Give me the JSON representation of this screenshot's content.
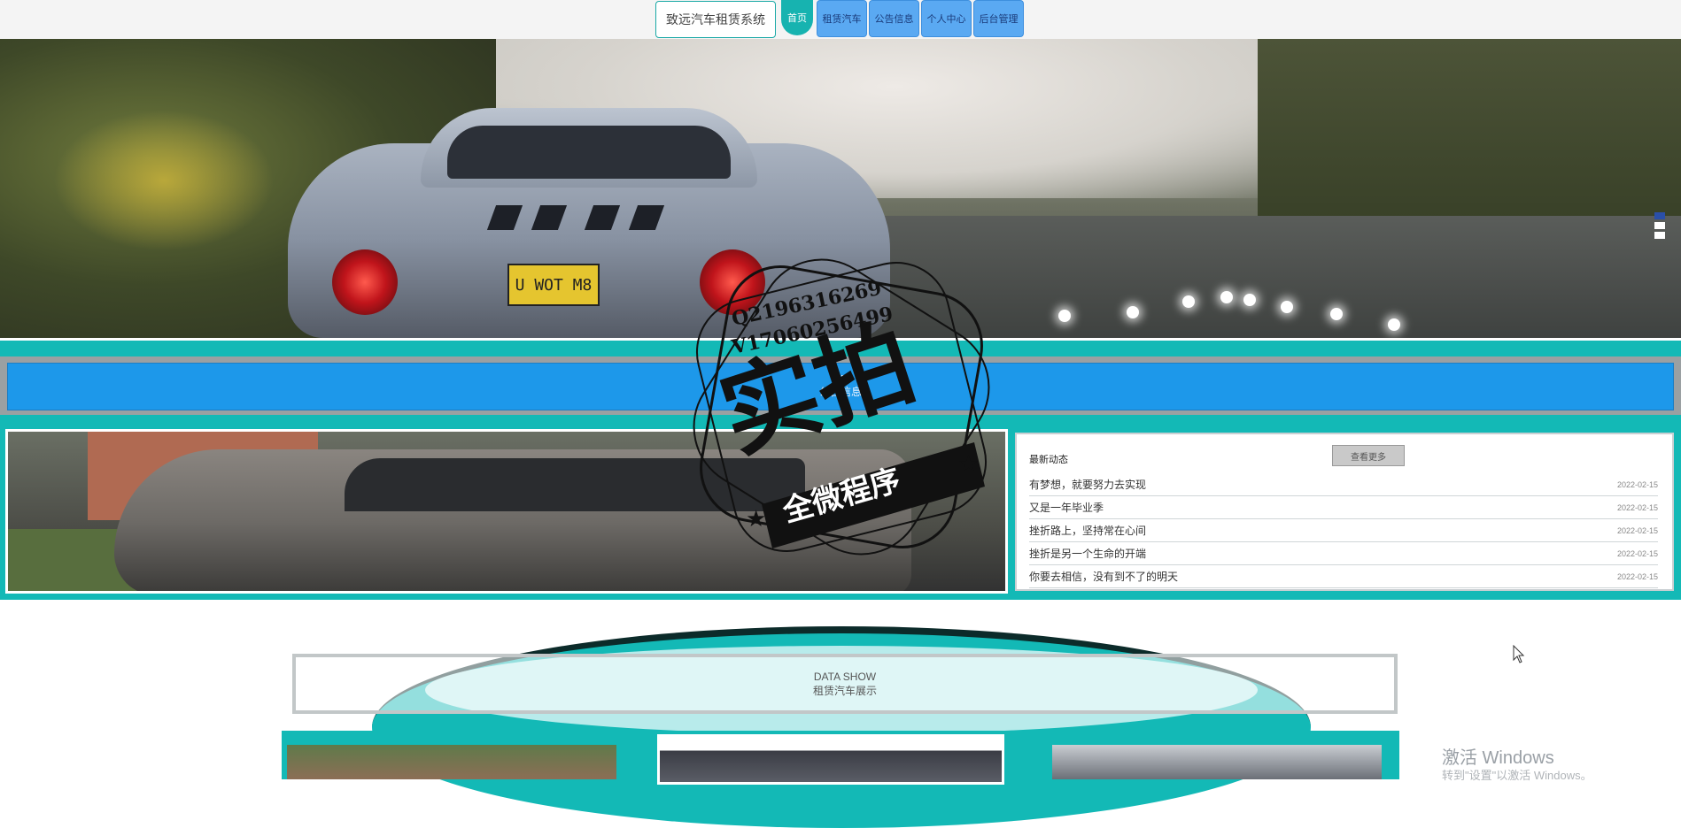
{
  "nav": {
    "brand": "致远汽车租赁系统",
    "home": "首页",
    "items": [
      "租赁汽车",
      "公告信息",
      "个人中心",
      "后台管理"
    ]
  },
  "hero": {
    "plate": "U WOT M8"
  },
  "notice": {
    "en": "NE",
    "cn": "公告信息"
  },
  "news": {
    "title": "最新动态",
    "more": "查看更多",
    "items": [
      {
        "text": "有梦想，就要努力去实现",
        "date": "2022-02-15"
      },
      {
        "text": "又是一年毕业季",
        "date": "2022-02-15"
      },
      {
        "text": "挫折路上，坚持常在心间",
        "date": "2022-02-15"
      },
      {
        "text": "挫折是另一个生命的开端",
        "date": "2022-02-15"
      },
      {
        "text": "你要去相信，没有到不了的明天",
        "date": "2022-02-15"
      }
    ]
  },
  "stamp": {
    "line1": "Q2196316269",
    "line2": "V17060256499",
    "main": "实拍",
    "ribbon": "全微程序"
  },
  "datashow": {
    "en": "DATA SHOW",
    "cn": "租赁汽车展示"
  },
  "os_watermark": {
    "title": "激活 Windows",
    "sub": "转到\"设置\"以激活 Windows。"
  },
  "colors": {
    "teal": "#13b9b6",
    "blue": "#1d98ea",
    "nav_blue": "#5aa9f2"
  }
}
